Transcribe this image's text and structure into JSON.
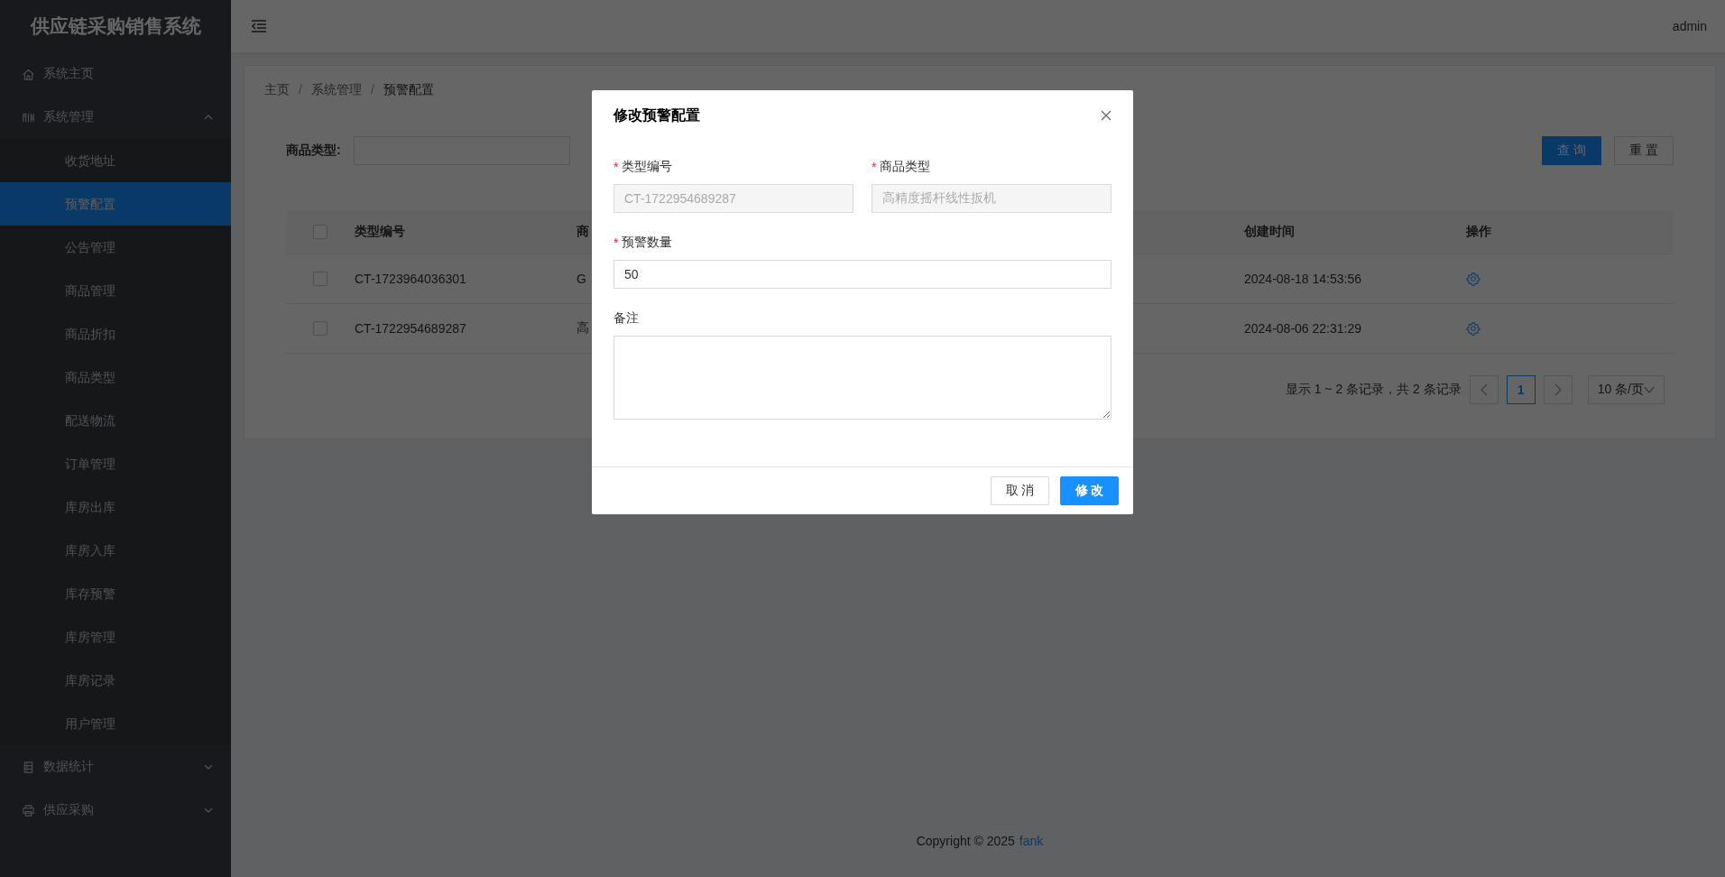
{
  "sidebar": {
    "title": "供应链采购销售系统",
    "items": [
      {
        "label": "系统主页",
        "selected": false
      },
      {
        "label": "系统管理",
        "expanded": true,
        "children": [
          {
            "label": "收货地址",
            "selected": false
          },
          {
            "label": "预警配置",
            "selected": true
          },
          {
            "label": "公告管理",
            "selected": false
          },
          {
            "label": "商品管理",
            "selected": false
          },
          {
            "label": "商品折扣",
            "selected": false
          },
          {
            "label": "商品类型",
            "selected": false
          },
          {
            "label": "配送物流",
            "selected": false
          },
          {
            "label": "订单管理",
            "selected": false
          },
          {
            "label": "库房出库",
            "selected": false
          },
          {
            "label": "库房入库",
            "selected": false
          },
          {
            "label": "库存预警",
            "selected": false
          },
          {
            "label": "库房管理",
            "selected": false
          },
          {
            "label": "库房记录",
            "selected": false
          },
          {
            "label": "用户管理",
            "selected": false
          }
        ]
      },
      {
        "label": "数据统计",
        "expanded": false
      },
      {
        "label": "供应采购",
        "expanded": false
      }
    ]
  },
  "header": {
    "user": "admin"
  },
  "breadcrumb": {
    "separator": "/",
    "items": [
      "主页",
      "系统管理",
      "预警配置"
    ]
  },
  "filter": {
    "label": "商品类型:"
  },
  "filter_buttons": [
    {
      "label": "查 询",
      "kind": "primary"
    },
    {
      "label": "重 置",
      "kind": "default"
    }
  ],
  "table": {
    "select_all": false,
    "columns": [
      "类型编号",
      "商",
      "创建时间",
      "操作"
    ],
    "rows": [
      {
        "checked": false,
        "cells": [
          "CT-1723964036301",
          "G",
          "2024-08-18 14:53:56"
        ]
      },
      {
        "checked": false,
        "cells": [
          "CT-1722954689287",
          "高",
          "2024-08-06 22:31:29"
        ]
      }
    ]
  },
  "pagination": {
    "summary": "显示 1 ~ 2 条记录，共 2 条记录",
    "pages": [
      {
        "label": "1",
        "selected": true
      }
    ],
    "page_size": "10 条/页"
  },
  "footer": {
    "text": "Copyright © 2025",
    "link": "fank"
  },
  "dialog": {
    "title": "修改预警配置",
    "required_mark": "*",
    "fields": [
      {
        "kind": "input",
        "label": "类型编号",
        "required": true,
        "disabled": true,
        "value": "CT-1722954689287"
      },
      {
        "kind": "input",
        "label": "商品类型",
        "required": true,
        "disabled": true,
        "value": "高精度摇杆线性扳机"
      },
      {
        "kind": "input",
        "label": "预警数量",
        "required": true,
        "disabled": false,
        "value": "50"
      },
      {
        "kind": "textarea",
        "label": "备注",
        "required": false
      }
    ],
    "buttons": [
      {
        "label": "取 消",
        "kind": "default"
      },
      {
        "label": "修 改",
        "kind": "primary"
      }
    ]
  }
}
